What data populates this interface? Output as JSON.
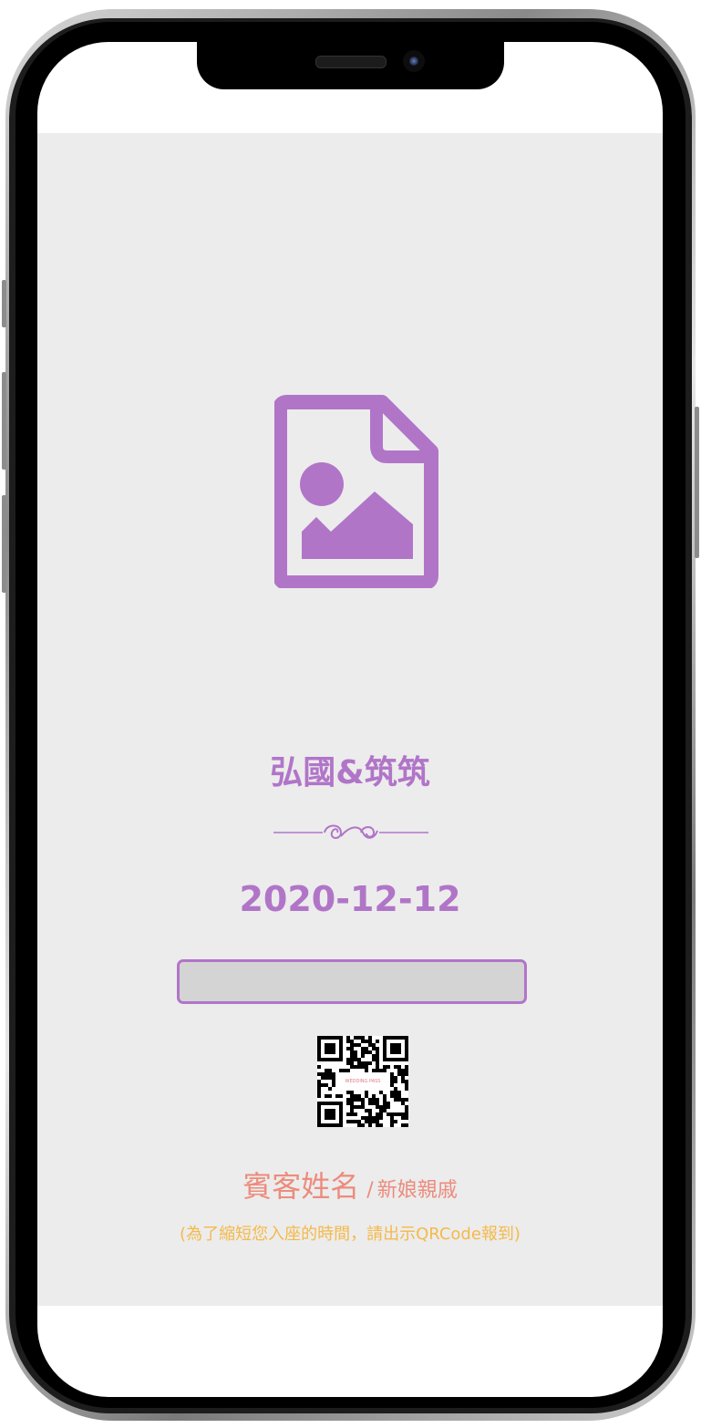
{
  "invitation": {
    "couple_names": "弘國&筑筑",
    "date": "2020-12-12",
    "name_field_value": "",
    "guest_name": "賓客姓名",
    "separator": "/",
    "guest_relation": "新娘親戚",
    "hint": "(為了縮短您入座的時間，請出示QRCode報到)",
    "qr_label": "WEDDING PASS"
  },
  "icons": {
    "hero": "image-file-icon",
    "ornament": "flourish-divider-icon",
    "qr": "qr-code-icon"
  },
  "colors": {
    "accent": "#b175c8",
    "guest": "#ec8c7d",
    "hint": "#f4b94a",
    "background": "#ececec"
  }
}
